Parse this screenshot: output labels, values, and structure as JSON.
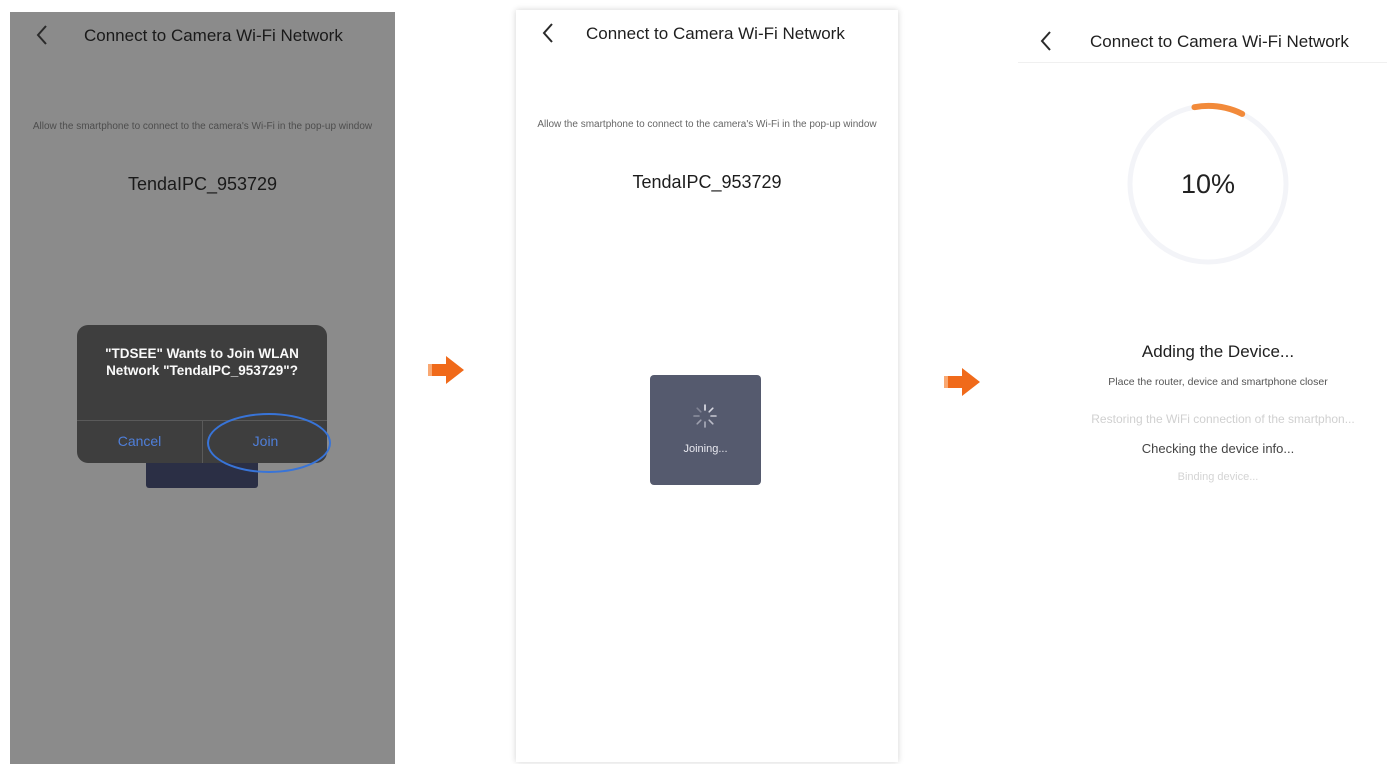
{
  "screen1": {
    "title": "Connect to Camera Wi-Fi Network",
    "hint": "Allow the smartphone to connect to the camera's Wi-Fi in the pop-up window",
    "ssid": "TendaIPC_953729",
    "alert": {
      "title": "\"TDSEE\" Wants to Join WLAN Network \"TendaIPC_953729\"?",
      "cancel_label": "Cancel",
      "join_label": "Join"
    }
  },
  "screen2": {
    "title": "Connect to Camera Wi-Fi Network",
    "hint": "Allow the smartphone to connect to the camera's Wi-Fi in the pop-up window",
    "ssid": "TendaIPC_953729",
    "toast": "Joining..."
  },
  "screen3": {
    "title": "Connect to Camera Wi-Fi Network",
    "progress_label": "10%",
    "progress_value": 0.1,
    "status_title": "Adding the Device...",
    "status_hint": "Place the router, device and smartphone closer",
    "steps": [
      "Restoring the WiFi connection of the smartphon...",
      "Checking the device info...",
      "Binding device..."
    ]
  },
  "colors": {
    "accent_orange": "#f28a3a",
    "arrow_orange": "#f06a1a",
    "ios_blue": "#4f7fd9",
    "highlight_ring": "#3874d8"
  },
  "icons": [
    "back-chevron-icon",
    "spinner-icon",
    "arrow-right-icon"
  ]
}
